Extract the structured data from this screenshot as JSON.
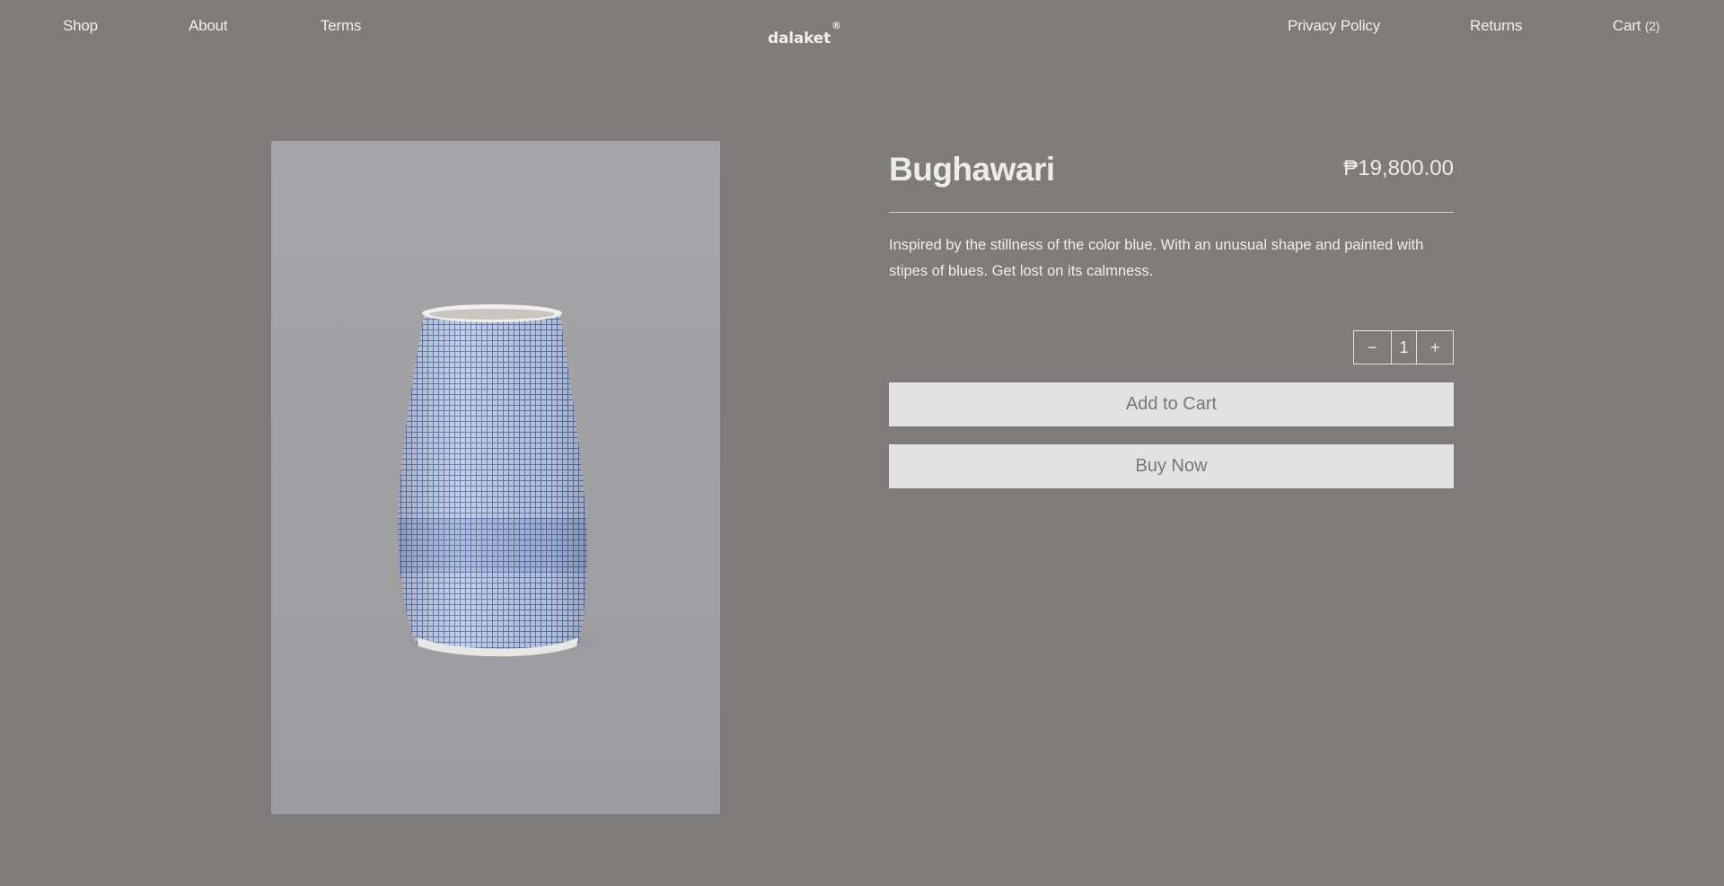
{
  "nav": {
    "left": [
      "Shop",
      "About",
      "Terms"
    ],
    "logo": "dalaket",
    "logo_mark": "®",
    "privacy": "Privacy Policy",
    "returns": "Returns",
    "cart_label": "Cart",
    "cart_count": "(2)"
  },
  "product": {
    "title": "Bughawari",
    "price": "₱19,800.00",
    "description": "Inspired by the stillness of the color blue. With an unusual shape and painted with stipes of blues. Get lost on its calmness.",
    "image": "blue crosshatch-painted ceramic vase"
  },
  "quantity": {
    "minus": "−",
    "value": "1",
    "plus": "+"
  },
  "buttons": {
    "add_to_cart": "Add to Cart",
    "buy_now": "Buy Now"
  },
  "colors": {
    "background": "#7f7b7a",
    "text": "#ececea",
    "button_bg": "#e2e2e2",
    "button_text": "#7a7676",
    "image_bg": "#a3a3a5",
    "vase_blue": "#4f6fb0"
  }
}
